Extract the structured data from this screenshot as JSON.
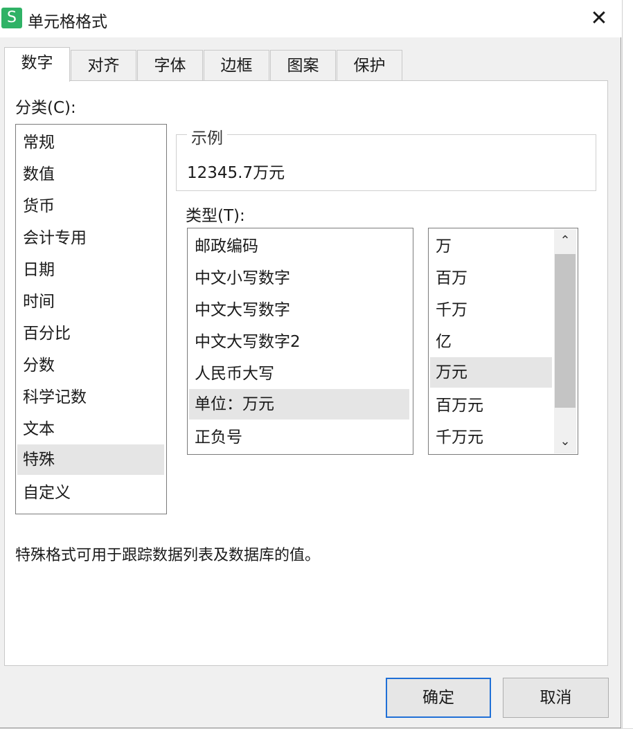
{
  "window": {
    "title": "单元格格式",
    "app_icon": "S",
    "close": "✕"
  },
  "tabs": [
    {
      "label": "数字",
      "active": true
    },
    {
      "label": "对齐",
      "active": false
    },
    {
      "label": "字体",
      "active": false
    },
    {
      "label": "边框",
      "active": false
    },
    {
      "label": "图案",
      "active": false
    },
    {
      "label": "保护",
      "active": false
    }
  ],
  "category": {
    "label": "分类(C):",
    "items": [
      "常规",
      "数值",
      "货币",
      "会计专用",
      "日期",
      "时间",
      "百分比",
      "分数",
      "科学记数",
      "文本",
      "特殊",
      "自定义"
    ],
    "selected": "特殊"
  },
  "sample": {
    "title": "示例",
    "value": "12345.7万元"
  },
  "type": {
    "label": "类型(T):",
    "items": [
      "邮政编码",
      "中文小写数字",
      "中文大写数字",
      "中文大写数字2",
      "人民币大写",
      "单位：万元",
      "正负号"
    ],
    "selected": "单位：万元"
  },
  "unit": {
    "items": [
      "万",
      "百万",
      "千万",
      "亿",
      "万元",
      "百万元",
      "千万元"
    ],
    "selected": "万元"
  },
  "description": "特殊格式可用于跟踪数据列表及数据库的值。",
  "buttons": {
    "ok": "确定",
    "cancel": "取消"
  },
  "colors": {
    "accent": "#1f6fd6",
    "app_icon": "#2fb266",
    "selection": "#e5e5e5"
  }
}
